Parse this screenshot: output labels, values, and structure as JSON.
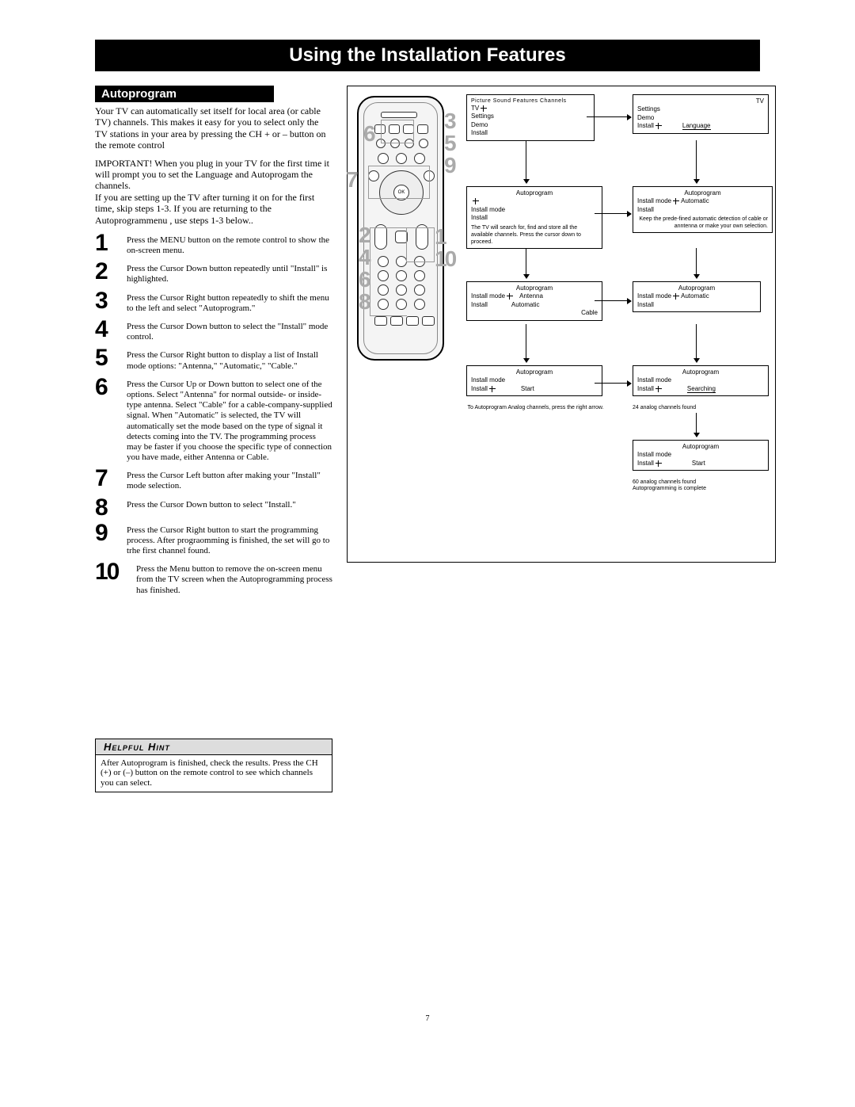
{
  "title": "Using the Installation Features",
  "subtitle": "Autoprogram",
  "intro1": "Your TV can automatically set itself for local area (or cable TV) channels. This makes it easy for you to select only the TV stations in your area by pressing the CH + or – button on the remote control",
  "intro2": "IMPORTANT!  When you plug in your TV for the first time it will prompt you to set the Language and Autoprogam the channels.",
  "intro3": "If you are setting up the TV after turning it on for the first time, skip steps 1-3.  If you are returning to the Autoprogrammenu , use steps 1-3 below..",
  "steps": [
    {
      "n": "1",
      "t": "Press the MENU button on the remote control to show the on-screen menu."
    },
    {
      "n": "2",
      "t": "Press the Cursor Down button repeatedly until \"Install\" is highlighted."
    },
    {
      "n": "3",
      "t": "Press the Cursor Right button repeatedly to shift the menu to the left and select \"Autoprogram.\""
    },
    {
      "n": "4",
      "t": "Press the Cursor Down button to select the \"Install\" mode control."
    },
    {
      "n": "5",
      "t": "Press the Cursor Right button to display a list of Install mode options: \"Antenna,\" \"Automatic,\" \"Cable.\""
    },
    {
      "n": "6",
      "t": "Press the Cursor Up or Down button to select one of the options. Select \"Antenna\" for normal outside- or inside-type antenna. Select \"Cable\" for a cable-company-supplied signal. When \"Automatic\" is selected, the TV will automatically set the mode based on the type of signal it detects coming into the TV. The programming process may be faster if you choose the specific type of connection you have made, either Antenna or Cable."
    },
    {
      "n": "7",
      "t": "Press the Cursor Left button after making your \"Install\" mode selection."
    },
    {
      "n": "8",
      "t": "Press the Cursor Down button to select \"Install.\""
    },
    {
      "n": "9",
      "t": "Press the Cursor Right button to start the programming process.  After prograomming is finished, the set will go to trhe first channel found."
    },
    {
      "n": "10",
      "t": "Press the Menu button to remove the on-screen menu from the TV screen when the Autoprogramming process has finished."
    }
  ],
  "hint_title": "Helpful Hint",
  "hint_body": "After Autoprogram is finished, check the results. Press the CH (+) or (–) button on the remote control to see which channels you can select.",
  "page_number": "7",
  "callout_nums": {
    "n1": "1",
    "n2": "2",
    "n3": "3",
    "n4": "4",
    "n5": "5",
    "n6": "6",
    "n6b": "6",
    "n7": "7",
    "n8": "8",
    "n9": "9",
    "n10": "10"
  },
  "menu1": {
    "hdr": "Picture   Sound   Features   Channels",
    "items": [
      "TV",
      "Settings",
      "Demo",
      "Install"
    ]
  },
  "menu2": {
    "hdr": "TV",
    "items": [
      "Settings",
      "Demo",
      "Install"
    ],
    "right": "Language"
  },
  "menu3": {
    "title": "Autoprogram",
    "items": [
      "Install mode",
      "Install"
    ],
    "note": "The TV will search for, find and store all the available channels. Press the cursor down to proceed."
  },
  "menu4": {
    "title": "Autoprogram",
    "items": [
      "Install mode",
      "Install"
    ],
    "right": "Automatic",
    "note": "Keep the prede-fined automatic detection of cable or anntenna or make your own selection."
  },
  "menu5": {
    "title": "Autoprogram",
    "items": [
      "Install mode",
      "Install"
    ],
    "opts": [
      "Antenna",
      "Automatic",
      "Cable"
    ]
  },
  "menu6": {
    "title": "Autoprogram",
    "items": [
      "Install mode",
      "Install"
    ],
    "right": "Automatic"
  },
  "menu7": {
    "title": "Autoprogram",
    "items": [
      "Install mode",
      "Install"
    ],
    "right": "Start",
    "caption": "To Autoprogram Analog channels, press the right arrow."
  },
  "menu8": {
    "title": "Autoprogram",
    "items": [
      "Install mode",
      "Install"
    ],
    "right": "Searching",
    "caption": "24 analog channels found"
  },
  "menu9": {
    "title": "Autoprogram",
    "items": [
      "Install mode",
      "Install"
    ],
    "right": "Start",
    "caption": "60 analog channels found\nAutoprogramming is complete"
  }
}
